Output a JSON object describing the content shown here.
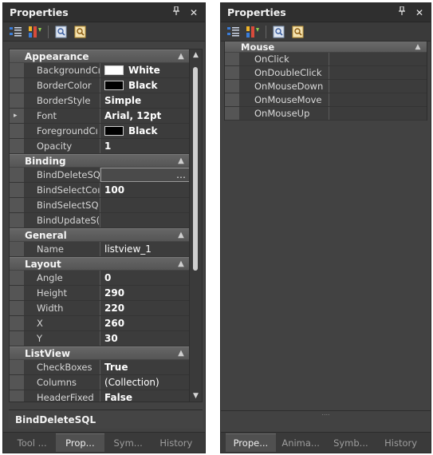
{
  "left_panel": {
    "title": "Properties",
    "pin_icon": "↑",
    "close_icon": "✕",
    "categories": [
      {
        "label": "Appearance",
        "properties": [
          {
            "name": "BackgroundCı",
            "value": "White",
            "swatch": "#ffffff"
          },
          {
            "name": "BorderColor",
            "value": "Black",
            "swatch": "#000000"
          },
          {
            "name": "BorderStyle",
            "value": "Simple"
          },
          {
            "name": "Font",
            "value": "Arial, 12pt",
            "expandable": true
          },
          {
            "name": "ForegroundCı",
            "value": "Black",
            "swatch": "#000000"
          },
          {
            "name": "Opacity",
            "value": "1"
          }
        ]
      },
      {
        "label": "Binding",
        "properties": [
          {
            "name": "BindDeleteSQ",
            "value": "",
            "selected": true,
            "ellipsis": "…"
          },
          {
            "name": "BindSelectCoı",
            "value": "100"
          },
          {
            "name": "BindSelectSQ",
            "value": ""
          },
          {
            "name": "BindUpdateS(",
            "value": ""
          }
        ]
      },
      {
        "label": "General",
        "properties": [
          {
            "name": "Name",
            "value": "listview_1",
            "normal": true
          }
        ]
      },
      {
        "label": "Layout",
        "properties": [
          {
            "name": "Angle",
            "value": "0"
          },
          {
            "name": "Height",
            "value": "290"
          },
          {
            "name": "Width",
            "value": "220"
          },
          {
            "name": "X",
            "value": "260"
          },
          {
            "name": "Y",
            "value": "30"
          }
        ]
      },
      {
        "label": "ListView",
        "properties": [
          {
            "name": "CheckBoxes",
            "value": "True"
          },
          {
            "name": "Columns",
            "value": "(Collection)",
            "normal": true
          },
          {
            "name": "HeaderFixed",
            "value": "False"
          }
        ]
      }
    ],
    "description": "BindDeleteSQL",
    "tabs": [
      {
        "label": "Tool ...",
        "active": false
      },
      {
        "label": "Prop...",
        "active": true
      },
      {
        "label": "Sym...",
        "active": false
      },
      {
        "label": "History",
        "active": false
      }
    ]
  },
  "right_panel": {
    "title": "Properties",
    "pin_icon": "↑",
    "close_icon": "✕",
    "category": "Mouse",
    "events": [
      "OnClick",
      "OnDoubleClick",
      "OnMouseDown",
      "OnMouseMove",
      "OnMouseUp"
    ],
    "tabs": [
      {
        "label": "Prope...",
        "active": true
      },
      {
        "label": "Anima...",
        "active": false
      },
      {
        "label": "Symb...",
        "active": false
      },
      {
        "label": "History",
        "active": false
      }
    ]
  },
  "icons": {
    "categorized": "categorized-icon",
    "alphabetical": "alphabetical-icon",
    "properties_view": "properties-view-icon",
    "events_view": "events-view-icon"
  }
}
